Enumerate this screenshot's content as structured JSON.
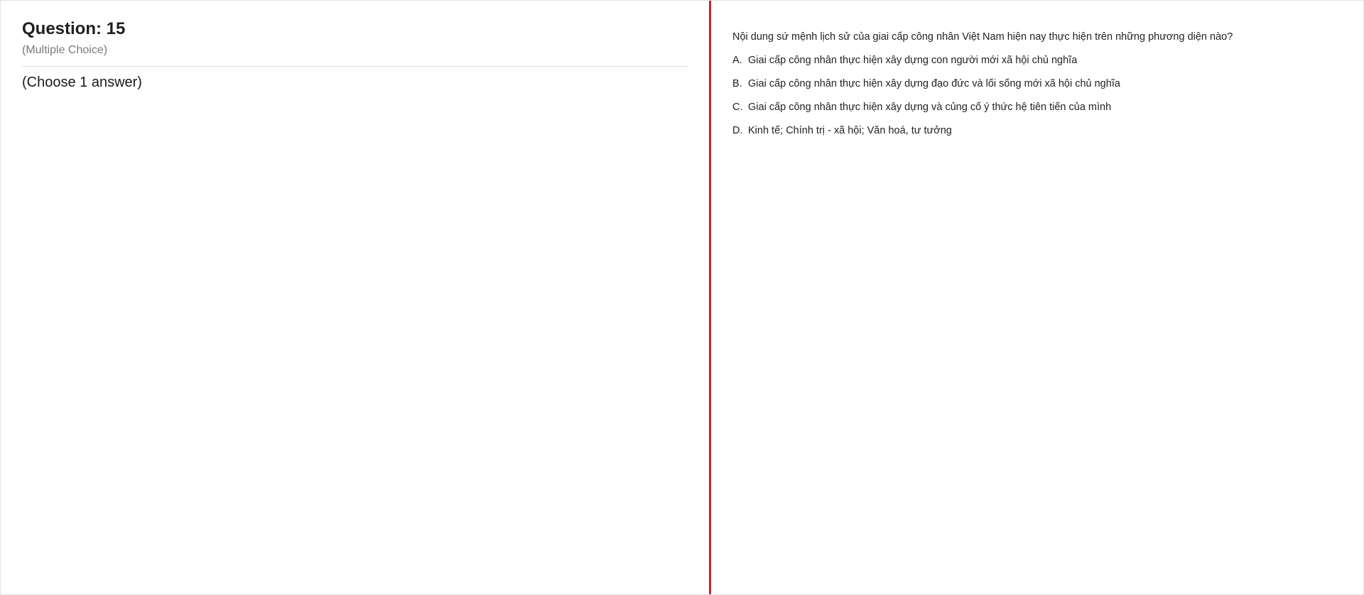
{
  "header": {
    "title": "Question: 15",
    "type": "(Multiple Choice)",
    "instruction": "(Choose 1 answer)"
  },
  "question": {
    "text": "Nội dung sứ mệnh lịch sử của giai cấp công nhân Việt Nam hiện nay thực hiện trên những phương diện nào?",
    "options": [
      {
        "letter": "A.",
        "text": "Giai cấp công nhân thực hiện xây dựng con người mới xã hội chủ nghĩa"
      },
      {
        "letter": "B.",
        "text": "Giai cấp công nhân thực hiện xây dựng đạo đức và lối sống mới xã hội chủ nghĩa"
      },
      {
        "letter": "C.",
        "text": "Giai cấp công nhân thực hiện xây dựng và củng cố ý thức hệ tiên tiến của mình"
      },
      {
        "letter": "D.",
        "text": "Kinh tế; Chính trị - xã hội; Văn hoá, tư tưởng"
      }
    ]
  },
  "colors": {
    "divider": "#c0272d",
    "title_text": "#1f1f1f",
    "subtitle_text": "#7a7a7a"
  }
}
